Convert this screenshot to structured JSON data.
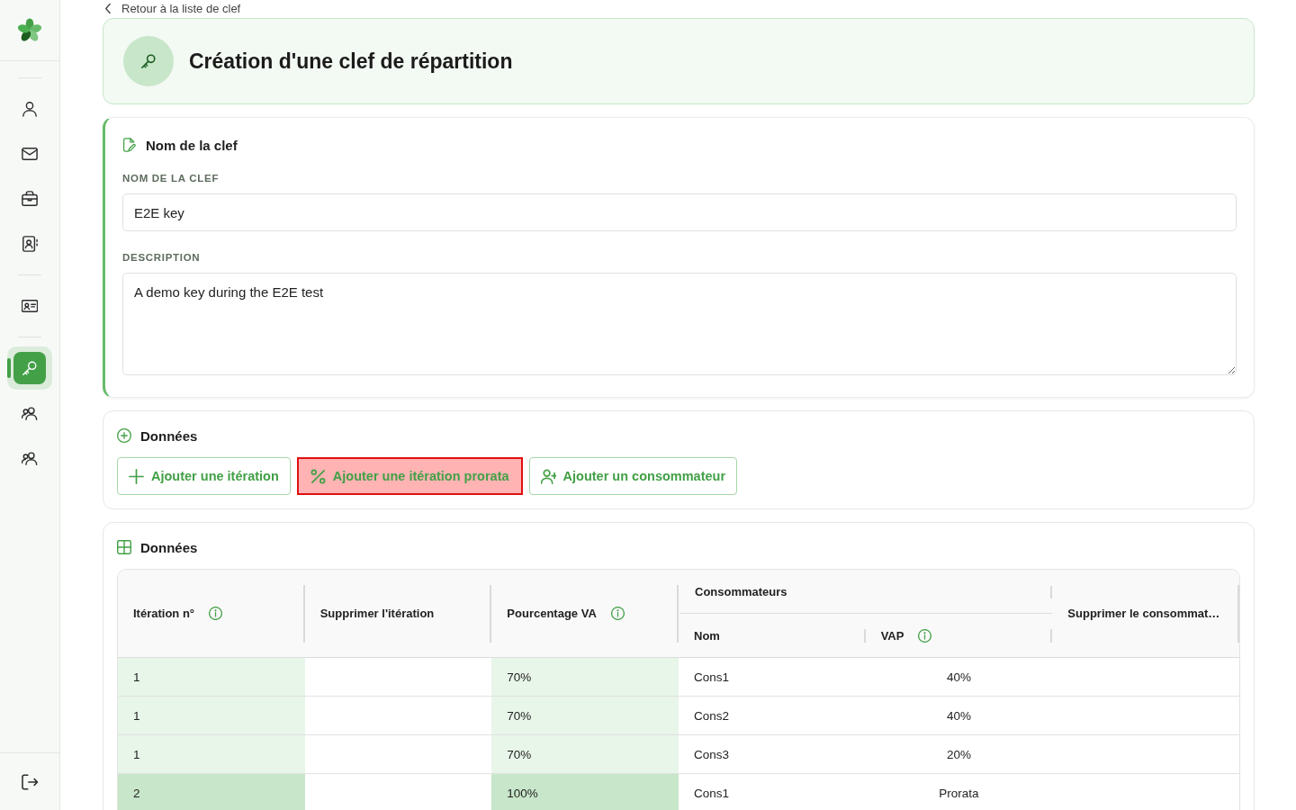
{
  "back_link": {
    "label": "Retour à la liste de clef"
  },
  "sidebar": {
    "groups": [
      {
        "items": [
          {
            "selected": false
          },
          {
            "selected": false
          },
          {
            "selected": false
          },
          {
            "selected": false
          }
        ]
      },
      {
        "items": [
          {
            "selected": false
          }
        ]
      },
      {
        "items": [
          {
            "selected": true
          },
          {
            "selected": false
          },
          {
            "selected": false
          }
        ]
      }
    ]
  },
  "header": {
    "title": "Création d'une clef de répartition"
  },
  "key_form": {
    "title": "Nom de la clef",
    "fields": [
      {
        "kind": "input",
        "label": "NOM DE LA CLEF",
        "value": "E2E key"
      },
      {
        "kind": "textarea",
        "label": "DESCRIPTION",
        "value": "A demo key during the E2E test"
      }
    ]
  },
  "actions": {
    "title": "Données",
    "buttons": [
      {
        "label": "Ajouter une itération",
        "highlighted": false
      },
      {
        "label": "Ajouter une itération prorata",
        "highlighted": true
      },
      {
        "label": "Ajouter un consommateur",
        "highlighted": false
      }
    ]
  },
  "table": {
    "title": "Données",
    "columns": [
      {
        "label": "Itération n°",
        "info": true
      },
      {
        "label": "Supprimer l'itération",
        "info": false
      },
      {
        "label": "Pourcentage VA",
        "info": true
      },
      {
        "label": "Consommateurs",
        "info": false,
        "children": [
          {
            "label": "Nom",
            "info": false
          },
          {
            "label": "VAP",
            "info": true
          }
        ]
      },
      {
        "label": "Supprimer le consommat…",
        "info": false
      }
    ],
    "rows": [
      {
        "iteration": "1",
        "percentage": "70%",
        "name": "Cons1",
        "vap": "40%",
        "color": "#e8f5e9"
      },
      {
        "iteration": "1",
        "percentage": "70%",
        "name": "Cons2",
        "vap": "40%",
        "color": "#e8f5e9"
      },
      {
        "iteration": "1",
        "percentage": "70%",
        "name": "Cons3",
        "vap": "20%",
        "color": "#e8f5e9"
      },
      {
        "iteration": "2",
        "percentage": "100%",
        "name": "Cons1",
        "vap": "Prorata",
        "color": "#c8e6c9"
      }
    ]
  }
}
